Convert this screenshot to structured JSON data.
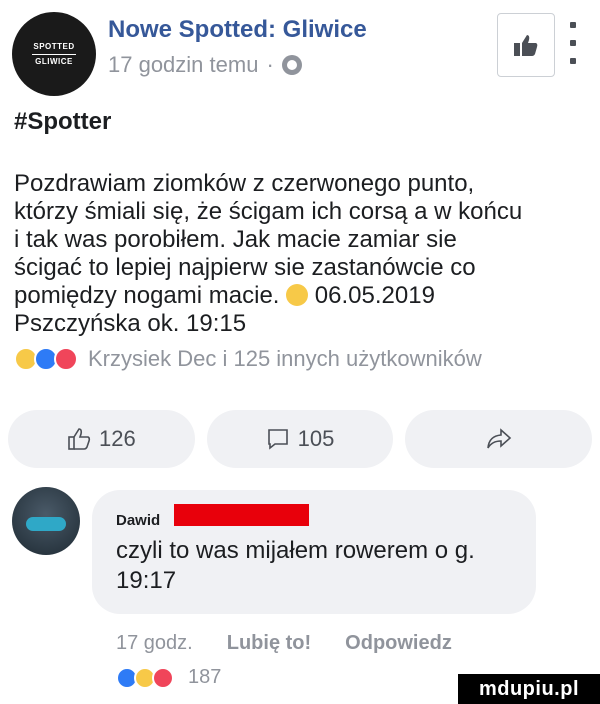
{
  "page": {
    "name": "Nowe Spotted: Gliwice",
    "avatar_lines": [
      "SPOTTED",
      "GLIWICE"
    ],
    "time": "17 godzin temu",
    "separator": "·"
  },
  "post": {
    "hashtag": "#Spotter",
    "body_lines": [
      "Pozdrawiam ziomków z czerwonego punto,",
      "którzy śmiali się, że ścigam ich corsą a w końcu",
      "i tak was porobiłem. Jak macie zamiar sie",
      "ścigać to lepiej najpierw sie zastanówcie co",
      "pomiędzy nogami macie.",
      "Pszczyńska ok. 19:15"
    ],
    "body_line5_suffix": "06.05.2019"
  },
  "reactions": {
    "summary": "Krzysiek Dec i 125 innych użytkowników"
  },
  "actions": {
    "like_count": "126",
    "comment_count": "105"
  },
  "comment": {
    "author": "Dawid",
    "text_lines": [
      "czyli to was mijałem rowerem o g.",
      "19:17"
    ],
    "time": "17 godz.",
    "like_label": "Lubię to!",
    "reply_label": "Odpowiedz",
    "reaction_count": "187"
  },
  "watermark": "mdupiu.pl",
  "colors": {
    "link_blue": "#365899",
    "meta_gray": "#90949c",
    "redaction_red": "#e8000b",
    "like_blue": "#2e7bf6",
    "love_red": "#f0455a",
    "haha_yellow": "#f7c948"
  }
}
